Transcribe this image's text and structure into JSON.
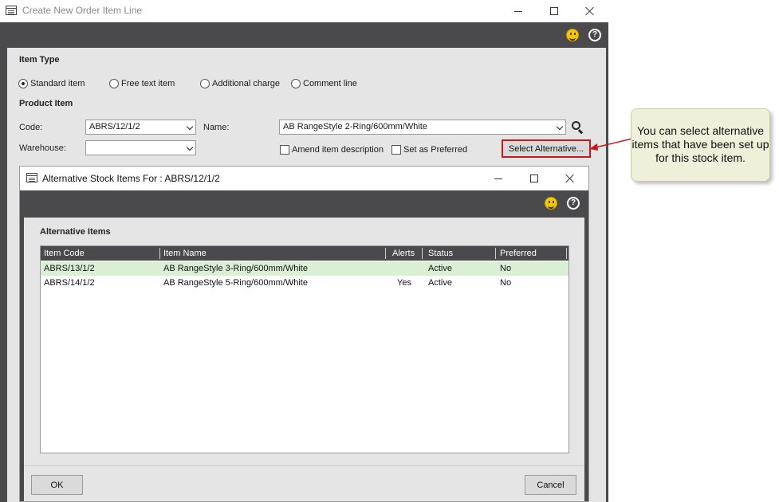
{
  "outer_window": {
    "title": "Create New Order Item Line",
    "item_type_label": "Item Type",
    "item_type_options": [
      "Standard item",
      "Free text item",
      "Additional charge",
      "Comment line"
    ],
    "selected_item_type": "Standard item",
    "product_item_label": "Product Item",
    "code_label": "Code:",
    "code_value": "ABRS/12/1/2",
    "name_label": "Name:",
    "name_value": "AB RangeStyle 2-Ring/600mm/White",
    "warehouse_label": "Warehouse:",
    "warehouse_value": "",
    "amend_description_label": "Amend item description",
    "set_preferred_label": "Set as Preferred",
    "select_alternative_label": "Select Alternative...",
    "help_glyph": "?"
  },
  "callout": {
    "text": "You can select alternative items that have been set up for this stock item."
  },
  "dialog": {
    "title": "Alternative Stock Items For : ABRS/12/1/2",
    "section_title": "Alternative Items",
    "help_glyph": "?",
    "columns": [
      "Item Code",
      "Item Name",
      "Alerts",
      "Status",
      "Preferred"
    ],
    "rows": [
      {
        "code": "ABRS/13/1/2",
        "name": "AB RangeStyle 3-Ring/600mm/White",
        "alerts": "",
        "status": "Active",
        "preferred": "No"
      },
      {
        "code": "ABRS/14/1/2",
        "name": "AB RangeStyle 5-Ring/600mm/White",
        "alerts": "Yes",
        "status": "Active",
        "preferred": "No"
      }
    ],
    "selected_row": 0,
    "ok_label": "OK",
    "cancel_label": "Cancel"
  },
  "colors": {
    "toolbar_dark": "#4a4a4d",
    "panel": "#e5e5e5",
    "selected_row": "#d9f0d5",
    "highlight_red": "#c41c1c",
    "callout_bg": "#eef0d9"
  }
}
